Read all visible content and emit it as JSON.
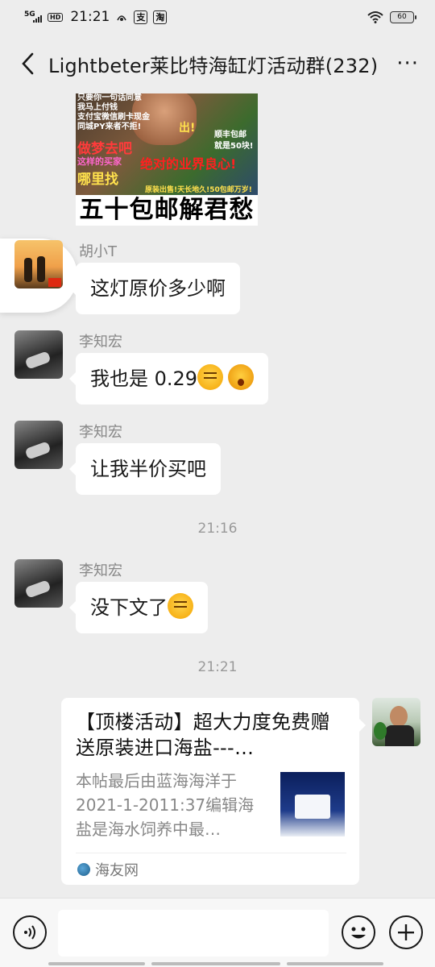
{
  "status_bar": {
    "network": "5G",
    "hd_badge": "HD",
    "time": "21:21",
    "app_icon_1": "支",
    "app_icon_2": "淘",
    "battery_level": "60"
  },
  "header": {
    "title": "Lightbeter莱比特海缸灯活动群(232)",
    "back_icon": "chevron-left-icon",
    "more_icon": "more-dots-icon",
    "more_label": "···"
  },
  "meme": {
    "caption": "五十包邮解君愁",
    "lines": [
      "只要你一句话同意",
      "我马上付钱",
      "支付宝微信刷卡现金",
      "同城PY来者不拒!",
      "做梦去吧",
      "这样的买家",
      "哪里找",
      "绝对的业界良心!",
      "出!",
      "就是50块!",
      "顺丰包邮",
      "原装出售!天长地久!50包邮万岁!"
    ]
  },
  "messages": [
    {
      "sender": "胡小T",
      "text": "这灯原价多少啊",
      "emojis": []
    },
    {
      "sender": "李知宏",
      "text": "我也是 0.29",
      "emojis": [
        "smirk-face-icon",
        "kiss-face-icon"
      ]
    },
    {
      "sender": "李知宏",
      "text": "让我半价买吧",
      "emojis": []
    },
    {
      "sender": "李知宏",
      "text": "没下文了",
      "emojis": [
        "sweat-face-icon"
      ]
    }
  ],
  "timestamps": [
    "21:16",
    "21:21"
  ],
  "link_card": {
    "title": "【顶楼活动】超大力度免费赠送原装进口海盐---…",
    "description": "本帖最后由蓝海海洋于2021-1-2011:37编辑海盐是海水饲养中最…",
    "source": "海友网"
  },
  "input_bar": {
    "placeholder": "",
    "voice_icon": "voice-icon",
    "emoji_icon": "emoji-icon",
    "plus_icon": "plus-icon"
  }
}
